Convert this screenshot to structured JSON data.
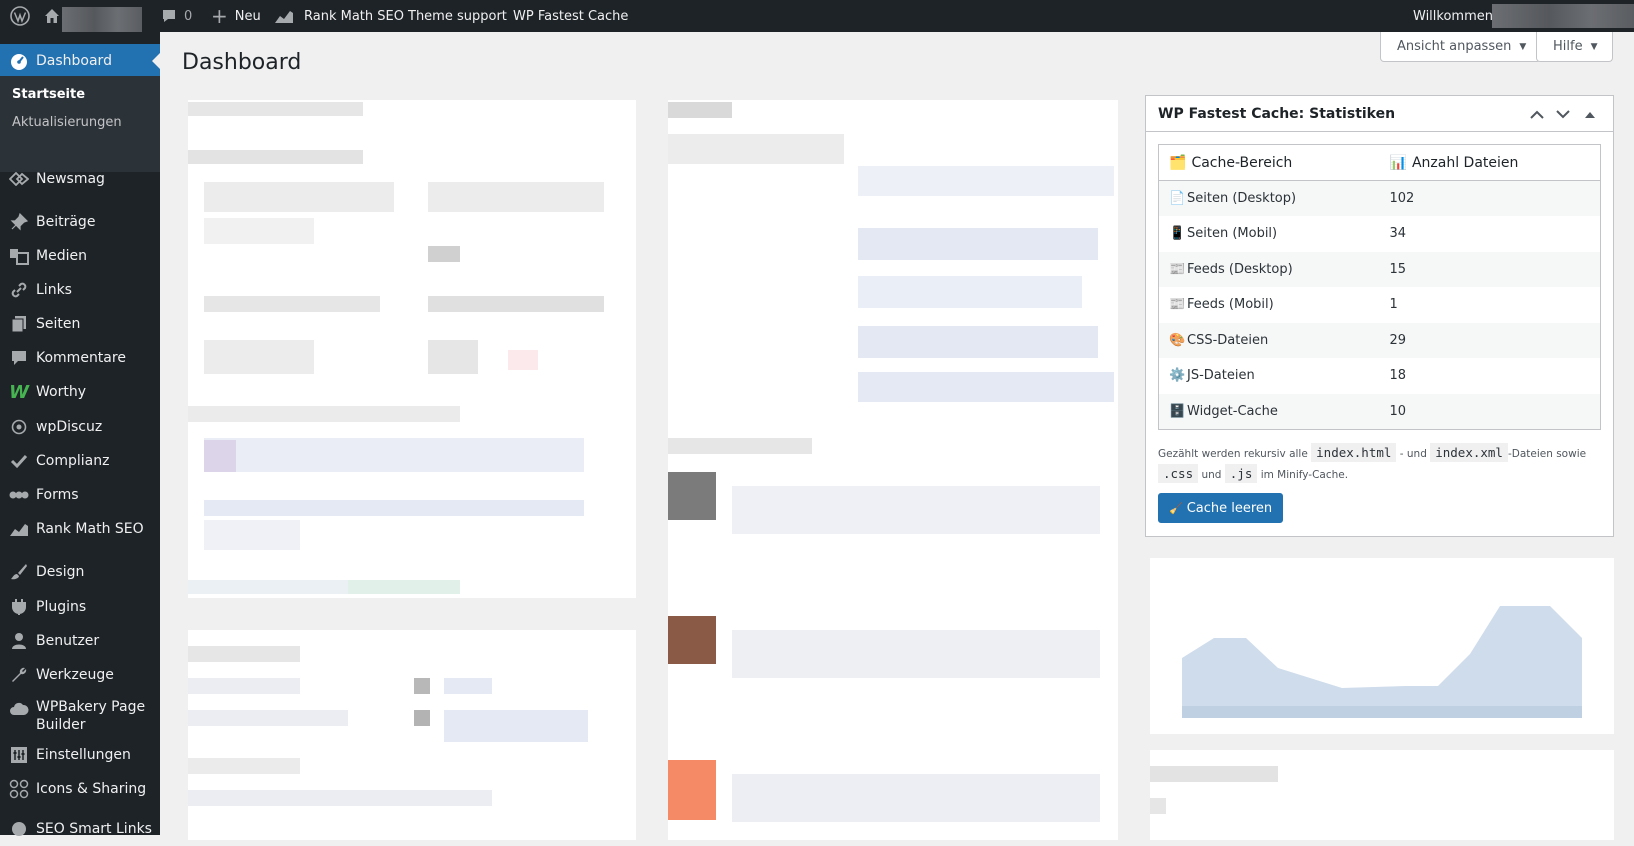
{
  "adminbar": {
    "comments_count": "0",
    "new_label": "Neu",
    "rank_math_label": "Rank Math SEO",
    "theme_support_label": "Theme support",
    "fastest_cache_label": "WP Fastest Cache",
    "welcome_label": "Willkommen,"
  },
  "sidebar": {
    "dashboard": "Dashboard",
    "submenu": [
      "Startseite",
      "Aktualisierungen"
    ],
    "items": [
      "Newsmag",
      "Beiträge",
      "Medien",
      "Links",
      "Seiten",
      "Kommentare",
      "Worthy",
      "wpDiscuz",
      "Complianz",
      "Forms",
      "Rank Math SEO",
      "Design",
      "Plugins",
      "Benutzer",
      "Werkzeuge",
      "WPBakery Page Builder",
      "Einstellungen",
      "Icons & Sharing",
      "SEO Smart Links"
    ],
    "items_wpbakery_line1": "WPBakery Page",
    "items_wpbakery_line2": "Builder"
  },
  "page": {
    "title": "Dashboard",
    "screen_options": "Ansicht anpassen",
    "help": "Hilfe"
  },
  "wpfc_widget": {
    "title": "WP Fastest Cache: Statistiken",
    "col_area": "Cache-Bereich",
    "col_count": "Anzahl Dateien",
    "rows": [
      {
        "label": "Seiten (Desktop)",
        "count": "102",
        "icon": "📄"
      },
      {
        "label": "Seiten (Mobil)",
        "count": "34",
        "icon": "📱"
      },
      {
        "label": "Feeds (Desktop)",
        "count": "15",
        "icon": "📰"
      },
      {
        "label": "Feeds (Mobil)",
        "count": "1",
        "icon": "📰"
      },
      {
        "label": "CSS-Dateien",
        "count": "29",
        "icon": "🎨"
      },
      {
        "label": "JS-Dateien",
        "count": "18",
        "icon": "⚙️"
      },
      {
        "label": "Widget-Cache",
        "count": "10",
        "icon": "🗄️"
      }
    ],
    "col_area_icon": "🗂️",
    "col_count_icon": "📊",
    "note_prefix": "Gezählt werden rekursiv alle",
    "note_code1": "index.html",
    "note_and1": "- und",
    "note_code2": "index.xml",
    "note_mid": "-Dateien sowie",
    "note_code3": ".css",
    "note_and2": "und",
    "note_code4": ".js",
    "note_suffix": "im Minify-Cache.",
    "clear_icon": "🧹",
    "clear_button": "Cache leeren"
  },
  "colors": {
    "admin_dark": "#1d2327",
    "accent_blue": "#2271b1",
    "submenu_bg": "#2c3338"
  }
}
